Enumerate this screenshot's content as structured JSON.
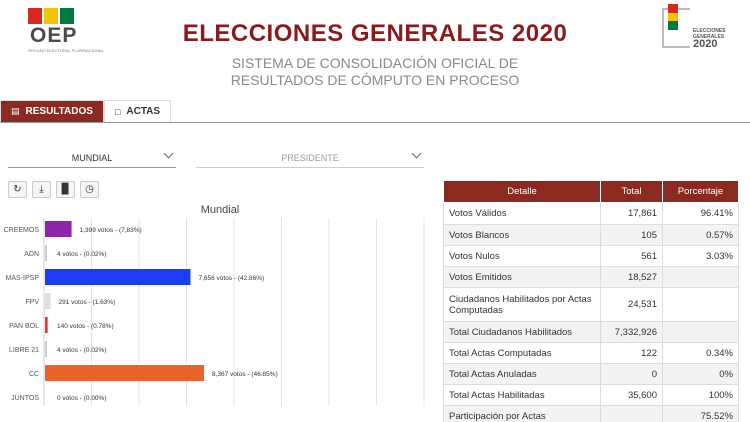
{
  "header": {
    "logo_left_text": "OEP",
    "logo_left_sub": "ÓRGANO ELECTORAL PLURINACIONAL",
    "title": "ELECCIONES GENERALES 2020",
    "subtitle": "SISTEMA DE CONSOLIDACIÓN OFICIAL DE RESULTADOS DE CÓMPUTO EN PROCESO",
    "logo_right_text": "ELECCIONES GENERALES",
    "logo_right_year": "2020"
  },
  "colors": {
    "title": "#8b1a1a",
    "accent": "#8b2a20",
    "flag_red": "#d52b1e",
    "flag_yellow": "#f4c400",
    "flag_green": "#007a3d"
  },
  "tabs": [
    {
      "label": "RESULTADOS",
      "icon": "bar-chart-icon"
    },
    {
      "label": "ACTAS",
      "icon": "file-icon"
    }
  ],
  "filters": {
    "scope": "MUNDIAL",
    "office": "PRESIDENTE"
  },
  "tools": [
    "refresh-icon",
    "download-icon",
    "bar-chart-icon",
    "clock-icon"
  ],
  "chart_data": {
    "type": "bar",
    "orientation": "horizontal",
    "title": "Mundial",
    "categories": [
      "CREEMOS",
      "ADN",
      "MAS-IPSP",
      "FPV",
      "PAN BOL",
      "LIBRE 21",
      "CC",
      "JUNTOS"
    ],
    "values": [
      1399,
      4,
      7656,
      291,
      140,
      4,
      8367,
      0
    ],
    "labels": [
      "1,399 votos - (7,83%)",
      "4 votos - (0.02%)",
      "7,656 votos - (42.86%)",
      "291 votos - (1.63%)",
      "140 votos - (0.78%)",
      "4 votos - (0.02%)",
      "8,367 votos - (46.85%)",
      "0 votos - (0.00%)"
    ],
    "colors": [
      "#8e24aa",
      "#cccccc",
      "#1a3df5",
      "#dddddd",
      "#e53935",
      "#cccccc",
      "#e8642a",
      "#cccccc"
    ],
    "xlim": [
      0,
      20000
    ],
    "grid": true
  },
  "table": {
    "headers": [
      "Detalle",
      "Total",
      "Porcentaje"
    ],
    "rows": [
      {
        "label": "Votos Válidos",
        "total": "17,861",
        "pct": "96.41%"
      },
      {
        "label": "Votos Blancos",
        "total": "105",
        "pct": "0.57%"
      },
      {
        "label": "Votos Nulos",
        "total": "561",
        "pct": "3.03%"
      },
      {
        "label": "Votos Emitidos",
        "total": "18,527",
        "pct": ""
      },
      {
        "label": "Ciudadanos Habilitados por Actas Computadas",
        "total": "24,531",
        "pct": ""
      },
      {
        "label": "Total Ciudadanos Habilitados",
        "total": "7,332,926",
        "pct": ""
      },
      {
        "label": "Total Actas Computadas",
        "total": "122",
        "pct": "0.34%"
      },
      {
        "label": "Total Actas Anuladas",
        "total": "0",
        "pct": "0%"
      },
      {
        "label": "Total Actas Habilitadas",
        "total": "35,600",
        "pct": "100%"
      },
      {
        "label": "Participación por Actas",
        "total": "",
        "pct": "75.52%"
      }
    ]
  }
}
